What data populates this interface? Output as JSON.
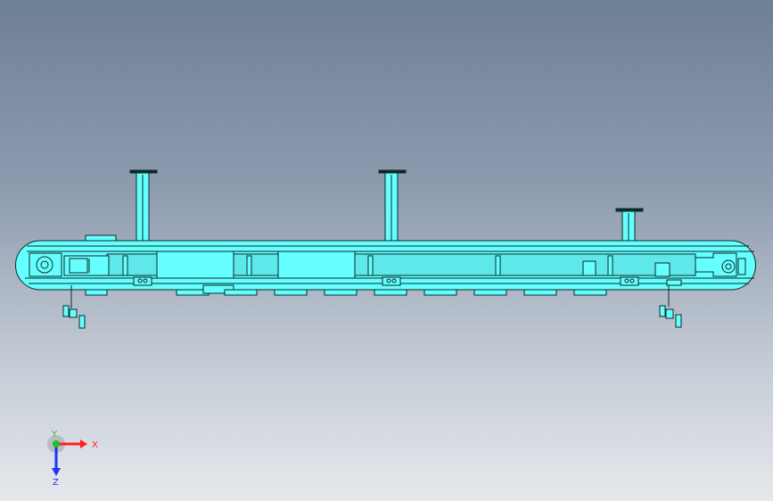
{
  "viewport": {
    "background_top": "#6e7f96",
    "background_bottom": "#e6e8ec"
  },
  "model": {
    "body_color": "#66ffff",
    "edge_color": "#0b2a2a"
  },
  "triad": {
    "x_label": "X",
    "y_label": "Y",
    "z_label": "Z",
    "x_color": "#ff2020",
    "y_color": "#20c020",
    "z_color": "#2030ff",
    "icon": "coordinate-triad-icon"
  }
}
